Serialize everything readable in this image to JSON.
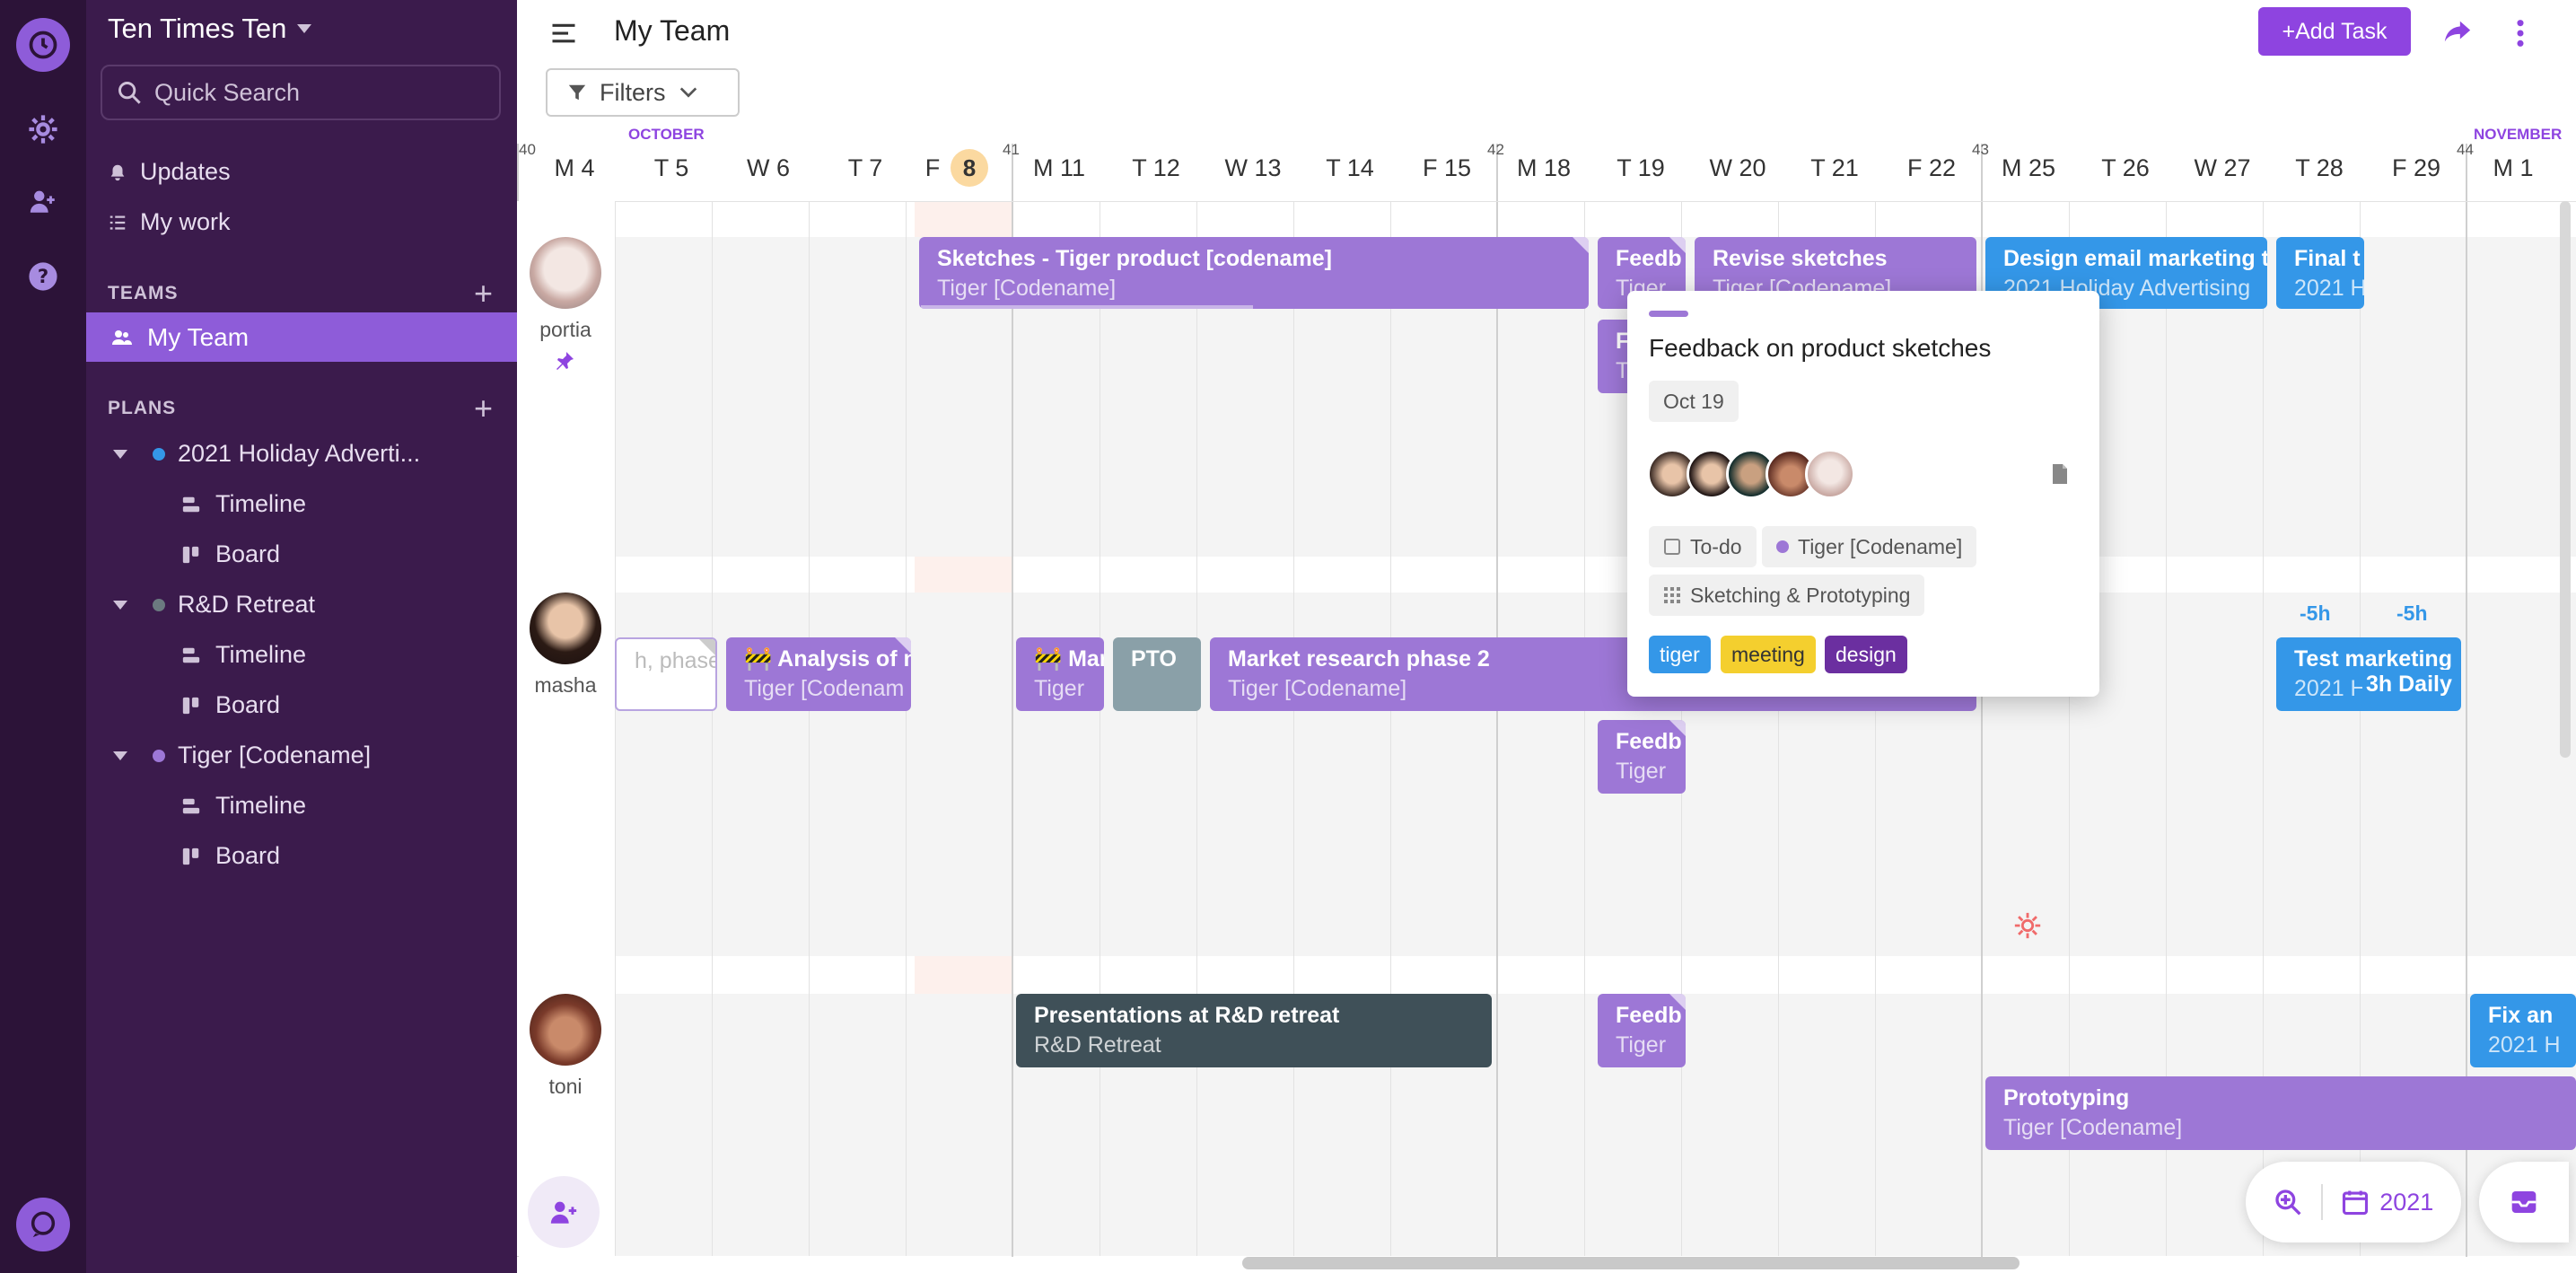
{
  "rail": {
    "icons": [
      "logo-icon",
      "gear-icon",
      "people-icon",
      "help-icon",
      "chat-icon"
    ]
  },
  "sidebar": {
    "workspace": "Ten Times Ten",
    "search_placeholder": "Quick Search",
    "links": [
      {
        "label": "Updates",
        "icon": "bell-icon"
      },
      {
        "label": "My work",
        "icon": "list-icon"
      }
    ],
    "teams_heading": "TEAMS",
    "active_team": "My Team",
    "plans_heading": "PLANS",
    "plans": [
      {
        "name": "2021 Holiday Adverti...",
        "color": "#3497e8",
        "items": [
          "Timeline",
          "Board"
        ]
      },
      {
        "name": "R&D Retreat",
        "color": "#6b7a80",
        "items": [
          "Timeline",
          "Board"
        ]
      },
      {
        "name": "Tiger [Codename]",
        "color": "#9d77d6",
        "items": [
          "Timeline",
          "Board"
        ]
      }
    ]
  },
  "topbar": {
    "title": "My Team",
    "add_task": "+Add Task",
    "filters": "Filters"
  },
  "timeline": {
    "month_labels": [
      "OCTOBER",
      "NOVEMBER"
    ],
    "week_numbers": [
      "40",
      "41",
      "42",
      "43",
      "44"
    ],
    "days": [
      "M 4",
      "T 5",
      "W 6",
      "T 7",
      "F",
      "M 11",
      "T 12",
      "W 13",
      "T 14",
      "F 15",
      "M 18",
      "T 19",
      "W 20",
      "T 21",
      "F 22",
      "M 25",
      "T 26",
      "W 27",
      "T 28",
      "F 29",
      "M 1"
    ],
    "today_number": "8",
    "people": [
      {
        "name": "portia"
      },
      {
        "name": "masha"
      },
      {
        "name": "toni"
      }
    ],
    "tasks": {
      "sketches": {
        "title": "Sketches - Tiger product [codename]",
        "sub": "Tiger [Codename]"
      },
      "feedb1": {
        "title": "Feedb",
        "sub": "Tiger"
      },
      "f2": {
        "title": "F",
        "sub": "T"
      },
      "revise": {
        "title": "Revise sketches",
        "sub": "Tiger [Codename]"
      },
      "design_email": {
        "title": "Design email marketing te",
        "sub": "2021 Holiday Advertising"
      },
      "final": {
        "title": "Final t",
        "sub": "2021 H"
      },
      "phase": {
        "title": "h, phase"
      },
      "analysis": {
        "title": "🚧 Analysis of m",
        "sub": "Tiger [Codenam"
      },
      "mar": {
        "title": "🚧 Mar",
        "sub": "Tiger"
      },
      "pto": {
        "title": "PTO"
      },
      "market": {
        "title": "Market research phase 2",
        "sub": "Tiger [Codename]"
      },
      "feedb2": {
        "title": "Feedb",
        "sub": "Tiger"
      },
      "test_marketing": {
        "title": "Test marketing",
        "sub": "2021 H"
      },
      "daily": {
        "title": "3h Daily"
      },
      "presentations": {
        "title": "Presentations at R&D retreat",
        "sub": "R&D Retreat"
      },
      "feedb3": {
        "title": "Feedb",
        "sub": "Tiger"
      },
      "prototyping": {
        "title": "Prototyping",
        "sub": "Tiger [Codename]"
      },
      "fixan": {
        "title": "Fix an",
        "sub": "2021 H"
      }
    },
    "budgets": [
      "-5h",
      "-5h"
    ]
  },
  "popup": {
    "title": "Feedback on product sketches",
    "date": "Oct 19",
    "status": "To-do",
    "plan": "Tiger [Codename]",
    "stage": "Sketching & Prototyping",
    "tags": [
      {
        "label": "tiger",
        "bg": "#3497e8",
        "fg": "#ffffff"
      },
      {
        "label": "meeting",
        "bg": "#f4cf2e",
        "fg": "#333333"
      },
      {
        "label": "design",
        "bg": "#6b2fa0",
        "fg": "#ffffff"
      }
    ]
  },
  "zoom": {
    "year": "2021"
  }
}
